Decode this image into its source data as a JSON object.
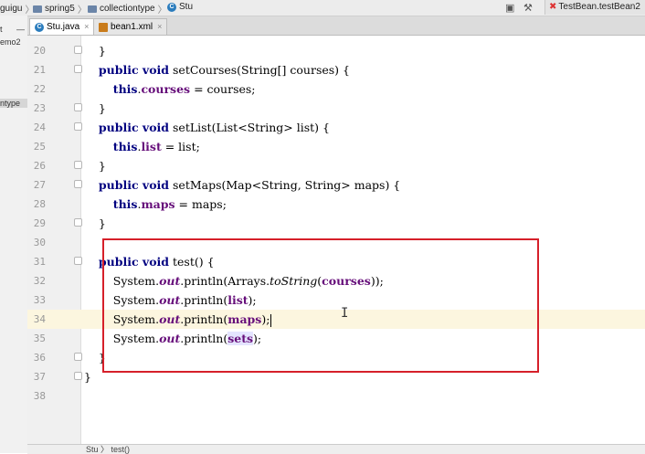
{
  "breadcrumbs": [
    "guigu",
    "spring5",
    "collectiontype",
    "Stu"
  ],
  "run_config": "TestBean.testBean2",
  "project_panel": {
    "items": [
      "emo2",
      "ntype"
    ],
    "header_labels": [
      "t",
      "—"
    ]
  },
  "tabs": [
    {
      "label": "Stu.java",
      "active": true
    },
    {
      "label": "bean1.xml",
      "active": false
    }
  ],
  "close_glyph": "×",
  "editor": {
    "current_line": 34,
    "lines": [
      {
        "num": "20",
        "text": "    }"
      },
      {
        "num": "21",
        "text": "    public void setCourses(String[] courses) {"
      },
      {
        "num": "22",
        "text": "        this.courses = courses;"
      },
      {
        "num": "23",
        "text": "    }"
      },
      {
        "num": "24",
        "text": "    public void setList(List<String> list) {"
      },
      {
        "num": "25",
        "text": "        this.list = list;"
      },
      {
        "num": "26",
        "text": "    }"
      },
      {
        "num": "27",
        "text": "    public void setMaps(Map<String, String> maps) {"
      },
      {
        "num": "28",
        "text": "        this.maps = maps;"
      },
      {
        "num": "29",
        "text": "    }"
      },
      {
        "num": "30",
        "text": ""
      },
      {
        "num": "31",
        "text": "    public void test() {"
      },
      {
        "num": "32",
        "text": "        System.out.println(Arrays.toString(courses));"
      },
      {
        "num": "33",
        "text": "        System.out.println(list);"
      },
      {
        "num": "34",
        "text": "        System.out.println(maps);"
      },
      {
        "num": "35",
        "text": "        System.out.println(sets);"
      },
      {
        "num": "36",
        "text": "    }"
      },
      {
        "num": "37",
        "text": "}"
      },
      {
        "num": "38",
        "text": ""
      }
    ]
  },
  "status_breadcrumb": "Stu  〉 test()",
  "colors": {
    "keyword": "#000080",
    "field": "#660e7a",
    "highlight_box": "#d6202a",
    "current_line": "#fcf6df"
  }
}
